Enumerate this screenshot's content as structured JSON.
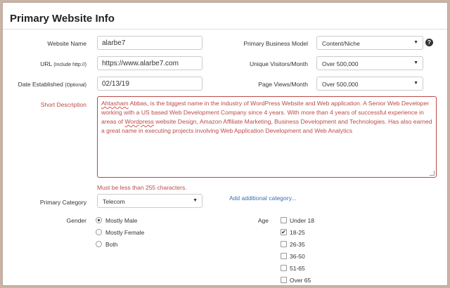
{
  "title": "Primary Website Info",
  "website_name": {
    "label": "Website Name",
    "value": "alarbe7"
  },
  "url": {
    "label": "URL",
    "hint": "(Include http://)",
    "value": "https://www.alarbe7.com"
  },
  "date_established": {
    "label": "Date Established",
    "hint": "(Optional)",
    "value": "02/13/19"
  },
  "business_model": {
    "label": "Primary Business Model",
    "value": "Content/Niche",
    "help_icon": "question-circle-icon"
  },
  "unique_visitors": {
    "label": "Unique Visitors/Month",
    "value": "Over 500,000"
  },
  "page_views": {
    "label": "Page Views/Month",
    "value": "Over 500,000"
  },
  "short_description": {
    "label": "Short Description",
    "text_parts": {
      "p1": "Ahtasham",
      "p2": " Abbas, is the biggest name in the industry of WordPress Website and Web application. A Senior Web Developer working with a US based Web Development Company since 4 years. With more than 4 years of successful experience in areas of ",
      "p3": "Wordpress",
      "p4": " website Design, Amazon Affiliate Marketing, Business Development and Technologies. Has also earned a great name in executing projects involving Web Application Development and Web Analytics"
    },
    "error": "Must be less than 255 characters."
  },
  "primary_category": {
    "label": "Primary Category",
    "value": "Telecom",
    "add_link": "Add additional category..."
  },
  "gender": {
    "label": "Gender",
    "options": [
      "Mostly Male",
      "Mostly Female",
      "Both"
    ],
    "selected": "Mostly Male"
  },
  "age": {
    "label": "Age",
    "options": [
      "Under 18",
      "18-25",
      "26-35",
      "36-50",
      "51-65",
      "Over 65"
    ],
    "checked": [
      "18-25"
    ],
    "check_mark": "✔"
  },
  "caret_glyph": "▼",
  "help_glyph": "?",
  "colors": {
    "error": "#b94a48",
    "link": "#3a6fb0",
    "frame": "#c8b3a4"
  }
}
